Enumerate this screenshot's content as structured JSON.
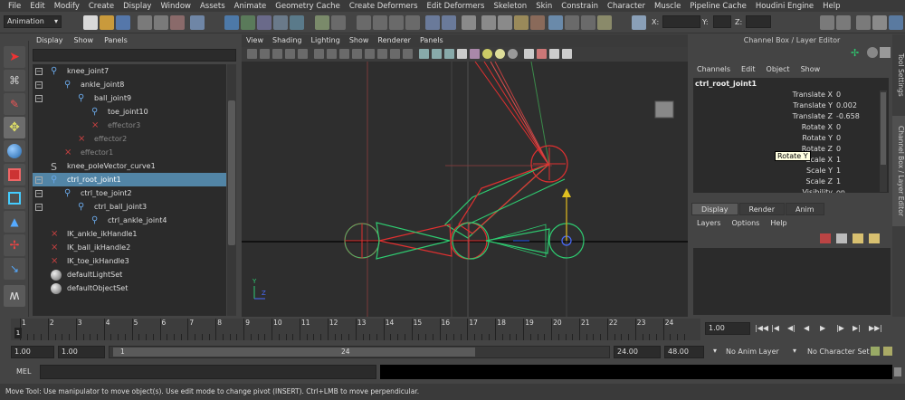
{
  "menubar": [
    "File",
    "Edit",
    "Modify",
    "Create",
    "Display",
    "Window",
    "Assets",
    "Animate",
    "Geometry Cache",
    "Create Deformers",
    "Edit Deformers",
    "Skeleton",
    "Skin",
    "Constrain",
    "Character",
    "Muscle",
    "Pipeline Cache",
    "Houdini Engine",
    "Help"
  ],
  "shelf": {
    "menu_set": "Animation",
    "x_label": "X:",
    "y_label": "Y:",
    "z_label": "Z:",
    "x_value": "",
    "y_value": "",
    "z_value": ""
  },
  "outliner": {
    "menus": [
      "Display",
      "Show",
      "Panels"
    ],
    "rows": [
      {
        "label": "knee_joint7",
        "indent": 0,
        "icon": "joint",
        "exp": "-",
        "dim": false,
        "selected": false
      },
      {
        "label": "ankle_joint8",
        "indent": 1,
        "icon": "joint",
        "exp": "-",
        "dim": false,
        "selected": false
      },
      {
        "label": "ball_joint9",
        "indent": 2,
        "icon": "joint",
        "exp": "-",
        "dim": false,
        "selected": false
      },
      {
        "label": "toe_joint10",
        "indent": 3,
        "icon": "joint",
        "exp": "",
        "dim": false,
        "selected": false
      },
      {
        "label": "effector3",
        "indent": 3,
        "icon": "effector",
        "exp": "",
        "dim": true,
        "selected": false
      },
      {
        "label": "effector2",
        "indent": 2,
        "icon": "effector",
        "exp": "",
        "dim": true,
        "selected": false
      },
      {
        "label": "effector1",
        "indent": 1,
        "icon": "effector",
        "exp": "",
        "dim": true,
        "selected": false
      },
      {
        "label": "knee_poleVector_curve1",
        "indent": 0,
        "icon": "curve",
        "exp": "",
        "dim": false,
        "selected": false
      },
      {
        "label": "ctrl_root_joint1",
        "indent": 0,
        "icon": "joint",
        "exp": "-",
        "dim": false,
        "selected": true
      },
      {
        "label": "ctrl_toe_joint2",
        "indent": 1,
        "icon": "joint",
        "exp": "-",
        "dim": false,
        "selected": false
      },
      {
        "label": "ctrl_ball_joint3",
        "indent": 2,
        "icon": "joint",
        "exp": "-",
        "dim": false,
        "selected": false
      },
      {
        "label": "ctrl_ankle_joint4",
        "indent": 3,
        "icon": "joint",
        "exp": "",
        "dim": false,
        "selected": false
      },
      {
        "label": "IK_ankle_ikHandle1",
        "indent": 0,
        "icon": "ik",
        "exp": "",
        "dim": false,
        "selected": false
      },
      {
        "label": "IK_ball_ikHandle2",
        "indent": 0,
        "icon": "ik",
        "exp": "",
        "dim": false,
        "selected": false
      },
      {
        "label": "IK_toe_ikHandle3",
        "indent": 0,
        "icon": "ik",
        "exp": "",
        "dim": false,
        "selected": false
      },
      {
        "label": "defaultLightSet",
        "indent": 0,
        "icon": "set",
        "exp": "",
        "dim": false,
        "selected": false
      },
      {
        "label": "defaultObjectSet",
        "indent": 0,
        "icon": "set",
        "exp": "",
        "dim": false,
        "selected": false
      }
    ]
  },
  "viewport": {
    "menus": [
      "View",
      "Shading",
      "Lighting",
      "Show",
      "Renderer",
      "Panels"
    ],
    "axis_y": "Y",
    "axis_z": "Z"
  },
  "channelbox": {
    "title": "Channel Box / Layer Editor",
    "menus": [
      "Channels",
      "Edit",
      "Object",
      "Show"
    ],
    "object_name": "ctrl_root_joint1",
    "attributes": [
      {
        "name": "Translate X",
        "value": "0"
      },
      {
        "name": "Translate Y",
        "value": "0.002"
      },
      {
        "name": "Translate Z",
        "value": "-0.658"
      },
      {
        "name": "Rotate X",
        "value": "0"
      },
      {
        "name": "Rotate Y",
        "value": "0"
      },
      {
        "name": "Rotate Z",
        "value": "0"
      },
      {
        "name": "Scale X",
        "value": "1"
      },
      {
        "name": "Scale Y",
        "value": "1"
      },
      {
        "name": "Scale Z",
        "value": "1"
      },
      {
        "name": "Visibility",
        "value": "on"
      }
    ],
    "tooltip": "Rotate Y",
    "layer_tabs": [
      "Display",
      "Render",
      "Anim"
    ],
    "layer_menus": [
      "Layers",
      "Options",
      "Help"
    ]
  },
  "side_tabs": [
    "Tool Settings",
    "Channel Box / Layer Editor"
  ],
  "timeline": {
    "ticks": [
      "1",
      "2",
      "3",
      "4",
      "5",
      "6",
      "7",
      "8",
      "9",
      "10",
      "11",
      "12",
      "13",
      "14",
      "15",
      "16",
      "17",
      "18",
      "19",
      "20",
      "21",
      "22",
      "23",
      "24"
    ],
    "current_frame": "1",
    "current_time_field": "1.00",
    "playback_buttons": [
      "go-to-start",
      "step-back-key",
      "step-back-frame",
      "play-backward",
      "play-forward",
      "step-forward-frame",
      "step-forward-key",
      "go-to-end"
    ]
  },
  "range": {
    "start": "1.00",
    "playback_start": "1.00",
    "slider_min": "1",
    "slider_max": "24",
    "playback_end": "24.00",
    "end": "48.00",
    "anim_layer": "No Anim Layer",
    "character_set": "No Character Set"
  },
  "mel": {
    "label": "MEL"
  },
  "status": "Move Tool: Use manipulator to move object(s). Use edit mode to change pivot (INSERT).  Ctrl+LMB to move perpendicular."
}
